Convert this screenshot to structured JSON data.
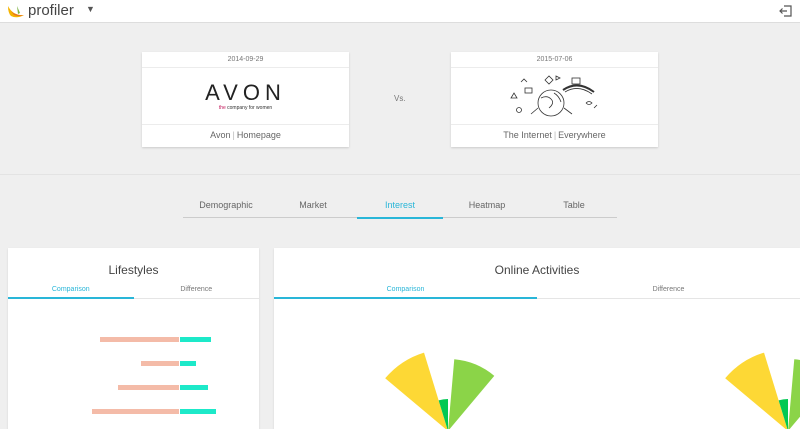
{
  "header": {
    "brand": "profiler",
    "dropdown_icon": "caret-down-icon",
    "logout_icon": "logout-icon",
    "colors": {
      "logo_yellow": "#f5b400",
      "logo_orange": "#e8711e",
      "logo_green": "#7cb342"
    }
  },
  "comparison": {
    "left": {
      "date": "2014-09-29",
      "logo_text": "AVON",
      "tagline_pink": "the",
      "tagline_rest": " company for women",
      "name": "Avon",
      "category": "Homepage"
    },
    "vs_label": "Vs.",
    "right": {
      "date": "2015-07-06",
      "illustration": "internet-doodle-icon",
      "name": "The Internet",
      "category": "Everywhere"
    }
  },
  "tabs": [
    {
      "label": "Demographic",
      "active": false
    },
    {
      "label": "Market",
      "active": false
    },
    {
      "label": "Interest",
      "active": true
    },
    {
      "label": "Heatmap",
      "active": false
    },
    {
      "label": "Table",
      "active": false
    }
  ],
  "accent_color": "#29b6d8",
  "lifestyles": {
    "title": "Lifestyles",
    "subtabs": [
      {
        "label": "Comparison",
        "active": true
      },
      {
        "label": "Difference",
        "active": false
      }
    ]
  },
  "online_activities": {
    "title": "Online Activities",
    "subtabs": [
      {
        "label": "Comparison",
        "active": true
      },
      {
        "label": "Difference",
        "active": false
      }
    ]
  },
  "chart_data": [
    {
      "type": "bar",
      "colors": {
        "left": "#f4bba8",
        "right": "#1de9c9"
      },
      "rows": [
        {
          "left": 0.79,
          "right": 0.31
        },
        {
          "left": 0.38,
          "right": 0.16
        },
        {
          "left": 0.61,
          "right": 0.28
        },
        {
          "left": 0.87,
          "right": 0.36
        }
      ]
    },
    {
      "type": "pie",
      "segments": [
        {
          "start": -50,
          "end": -17,
          "radius": 0.82,
          "color": "#fdd835"
        },
        {
          "start": -17,
          "end": 0,
          "radius": 0.32,
          "color": "#00c853"
        },
        {
          "start": 5,
          "end": 40,
          "radius": 0.72,
          "color": "#8bd448"
        }
      ]
    }
  ]
}
